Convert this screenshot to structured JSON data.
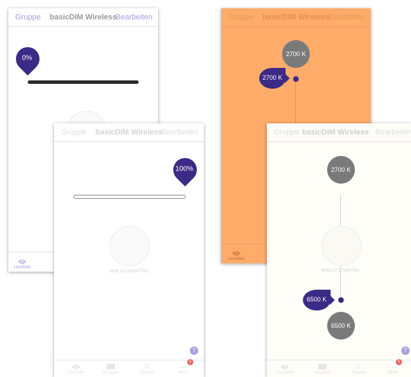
{
  "colors": {
    "accent": "#3b2a86",
    "link": "#a69be0",
    "orange": "#ffab6a",
    "cream": "#fffdf7",
    "circle_grey": "#7a7a7a"
  },
  "screen1": {
    "header": {
      "left": "Gruppe",
      "title": "basicDIM Wireless",
      "right": "Bearbeiten"
    },
    "pin_label": "0%",
    "slider_level": 0,
    "tab_label": "Leuchten"
  },
  "screen2": {
    "header": {
      "left": "Gruppe",
      "title": "basicDIM Wireless",
      "right": "Bearbeiten"
    },
    "pin_label": "100%",
    "slider_level": 1,
    "product_label": "60W (UV2450K/TW)",
    "tabs": [
      "Leuchten",
      "Gruppen",
      "Szenen",
      "Mehr"
    ],
    "help": "?",
    "badge": "1"
  },
  "screen3": {
    "header": {
      "left": "Gruppe",
      "title": "basicDIM Wireless",
      "right": "Bearbeiten"
    },
    "top_circle": "2700 K",
    "pin_label": "2700 K",
    "tab_label": "Leuchten"
  },
  "screen4": {
    "header": {
      "left": "Gruppe",
      "title": "basicDIM Wireless",
      "right": "Bearbeiten"
    },
    "top_circle": "2700 K",
    "pin_label": "6500 K",
    "bottom_circle": "6500 K",
    "product_label": "60W (UT2700K/TW)",
    "tabs": [
      "Leuchten",
      "Gruppen",
      "Szenen",
      "Mehr"
    ],
    "help": "?",
    "badge": "1"
  }
}
